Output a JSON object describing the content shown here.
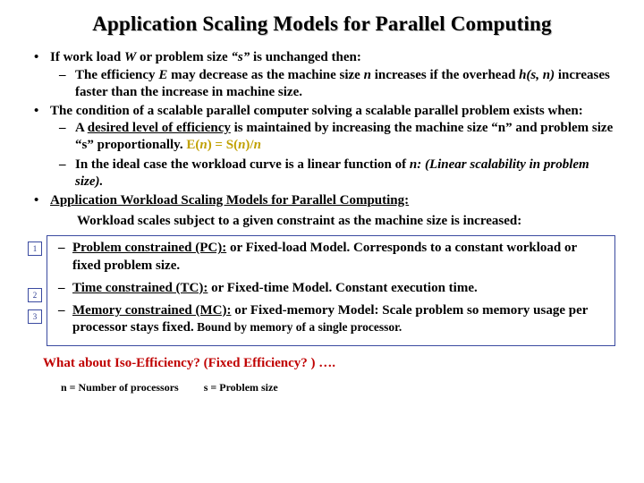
{
  "title": "Application Scaling Models for Parallel Computing",
  "b1": {
    "lead_a": "If work load ",
    "lead_w": "W",
    "lead_b": " or problem size ",
    "lead_s": "“s”",
    "lead_c": " is unchanged then:",
    "sub1_a": "The efficiency ",
    "sub1_e": "E",
    "sub1_b": " may decrease as the machine size ",
    "sub1_n": "n",
    "sub1_c": " increases if the overhead ",
    "sub1_h": "h(s, n)",
    "sub1_d": " increases faster than the increase in machine size."
  },
  "b2": {
    "lead": "The condition of a scalable parallel computer solving a scalable parallel problem exists when:",
    "sub1_a": "A ",
    "sub1_u": "desired level of efficiency",
    "sub1_b": " is maintained by increasing the machine size “n” and problem size “s” proportionally. ",
    "sub1_eq_a": "E(",
    "sub1_eq_n1": "n",
    "sub1_eq_b": ")  =  S(",
    "sub1_eq_n2": "n",
    "sub1_eq_c": ")/",
    "sub1_eq_n3": "n",
    "sub2_a": "In the ideal case the workload curve is a linear function of ",
    "sub2_n": "n: (Linear scalability in problem size)."
  },
  "b3": {
    "lead": "Application Workload Scaling Models for Parallel Computing:",
    "note": "Workload scales subject to a given constraint as the machine size is increased:"
  },
  "models": {
    "n1": "1",
    "n2": "2",
    "n3": "3",
    "m1_a": "Problem constrained (PC):",
    "m1_b": "  or Fixed-load Model.  Corresponds to a constant workload or fixed problem size.",
    "m2_a": "Time constrained (TC):",
    "m2_b": "  or Fixed-time Model.  Constant execution time.",
    "m3_a": "Memory constrained (MC):",
    "m3_b": "  or Fixed-memory Model:  Scale problem so memory usage per processor stays fixed.",
    "m3_c": "  Bound  by memory of a single processor."
  },
  "iso": "What about Iso-Efficiency? (Fixed Efficiency? ) ….",
  "legend": {
    "n": "n = Number of processors",
    "s": "s = Problem size"
  }
}
